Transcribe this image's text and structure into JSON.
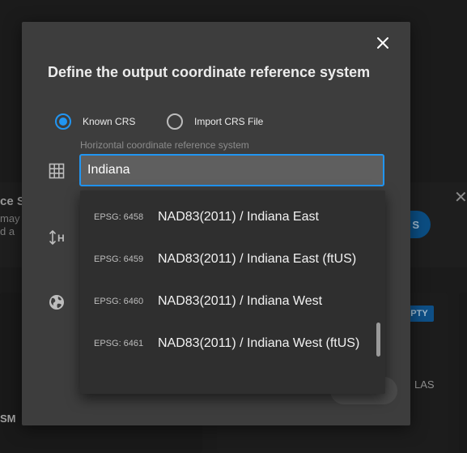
{
  "background": {
    "banner_title": "ce S",
    "banner_line1": "may",
    "banner_line2": "d a",
    "pill_label": "S",
    "tag_label": "PTY",
    "las_label": "LAS",
    "card_label": "SM"
  },
  "dialog": {
    "title": "Define the output coordinate reference system",
    "close_icon": "close-icon",
    "radio_options": [
      {
        "label": "Known CRS",
        "checked": true
      },
      {
        "label": "Import CRS File",
        "checked": false
      }
    ],
    "field_label": "Horizontal coordinate reference system",
    "search_value": "Indiana",
    "dropdown": [
      {
        "code": "EPSG: 6458",
        "name": "NAD83(2011) / Indiana East"
      },
      {
        "code": "EPSG: 6459",
        "name": "NAD83(2011) / Indiana East (ftUS)"
      },
      {
        "code": "EPSG: 6460",
        "name": "NAD83(2011) / Indiana West"
      },
      {
        "code": "EPSG: 6461",
        "name": "NAD83(2011) / Indiana West (ftUS)"
      }
    ],
    "icons": [
      "grid-icon",
      "height-icon",
      "globe-icon"
    ],
    "height_icon_letter": "H"
  },
  "colors": {
    "accent": "#2196f3",
    "modal_bg": "#3d3d3d",
    "dropdown_bg": "#2f2f2f",
    "input_bg": "#5f5f5f"
  }
}
